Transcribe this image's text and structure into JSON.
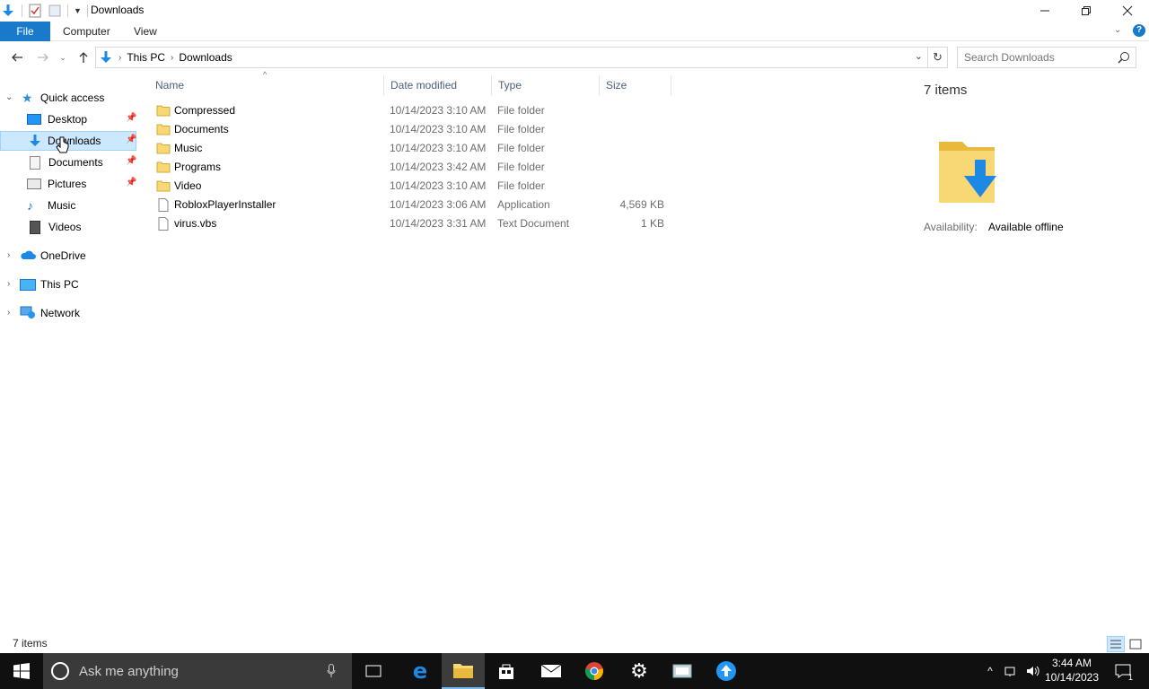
{
  "window": {
    "title": "Downloads"
  },
  "ribbon": {
    "tabs": [
      {
        "label": "File"
      },
      {
        "label": "Computer"
      },
      {
        "label": "View"
      }
    ]
  },
  "address": {
    "breadcrumbs": [
      "This PC",
      "Downloads"
    ],
    "search_placeholder": "Search Downloads"
  },
  "sidebar": {
    "quick_access": "Quick access",
    "items": [
      {
        "label": "Desktop",
        "icon": "desktop-icon",
        "pinned": true
      },
      {
        "label": "Downloads",
        "icon": "downloads-icon",
        "pinned": true,
        "selected": true
      },
      {
        "label": "Documents",
        "icon": "documents-icon",
        "pinned": true
      },
      {
        "label": "Pictures",
        "icon": "pictures-icon",
        "pinned": true
      },
      {
        "label": "Music",
        "icon": "music-icon",
        "pinned": false
      },
      {
        "label": "Videos",
        "icon": "videos-icon",
        "pinned": false
      }
    ],
    "roots": [
      {
        "label": "OneDrive",
        "icon": "onedrive-icon"
      },
      {
        "label": "This PC",
        "icon": "this-pc-icon"
      },
      {
        "label": "Network",
        "icon": "network-icon"
      }
    ]
  },
  "columns": {
    "name": "Name",
    "date": "Date modified",
    "type": "Type",
    "size": "Size"
  },
  "files": [
    {
      "name": "Compressed",
      "date": "10/14/2023 3:10 AM",
      "type": "File folder",
      "size": "",
      "icon": "folder-icon"
    },
    {
      "name": "Documents",
      "date": "10/14/2023 3:10 AM",
      "type": "File folder",
      "size": "",
      "icon": "folder-icon"
    },
    {
      "name": "Music",
      "date": "10/14/2023 3:10 AM",
      "type": "File folder",
      "size": "",
      "icon": "folder-icon"
    },
    {
      "name": "Programs",
      "date": "10/14/2023 3:42 AM",
      "type": "File folder",
      "size": "",
      "icon": "folder-icon"
    },
    {
      "name": "Video",
      "date": "10/14/2023 3:10 AM",
      "type": "File folder",
      "size": "",
      "icon": "folder-icon"
    },
    {
      "name": "RobloxPlayerInstaller",
      "date": "10/14/2023 3:06 AM",
      "type": "Application",
      "size": "4,569 KB",
      "icon": "file-icon"
    },
    {
      "name": "virus.vbs",
      "date": "10/14/2023 3:31 AM",
      "type": "Text Document",
      "size": "1 KB",
      "icon": "file-icon"
    }
  ],
  "details": {
    "count": "7 items",
    "availability_label": "Availability:",
    "availability_value": "Available offline"
  },
  "status": {
    "text": "7 items"
  },
  "taskbar": {
    "search_placeholder": "Ask me anything",
    "time": "3:44 AM",
    "date": "10/14/2023",
    "notification_count": "1"
  },
  "colors": {
    "accent": "#1979ca",
    "selection": "#cce8ff",
    "folder": "#f8d775",
    "taskbar": "#101010"
  }
}
